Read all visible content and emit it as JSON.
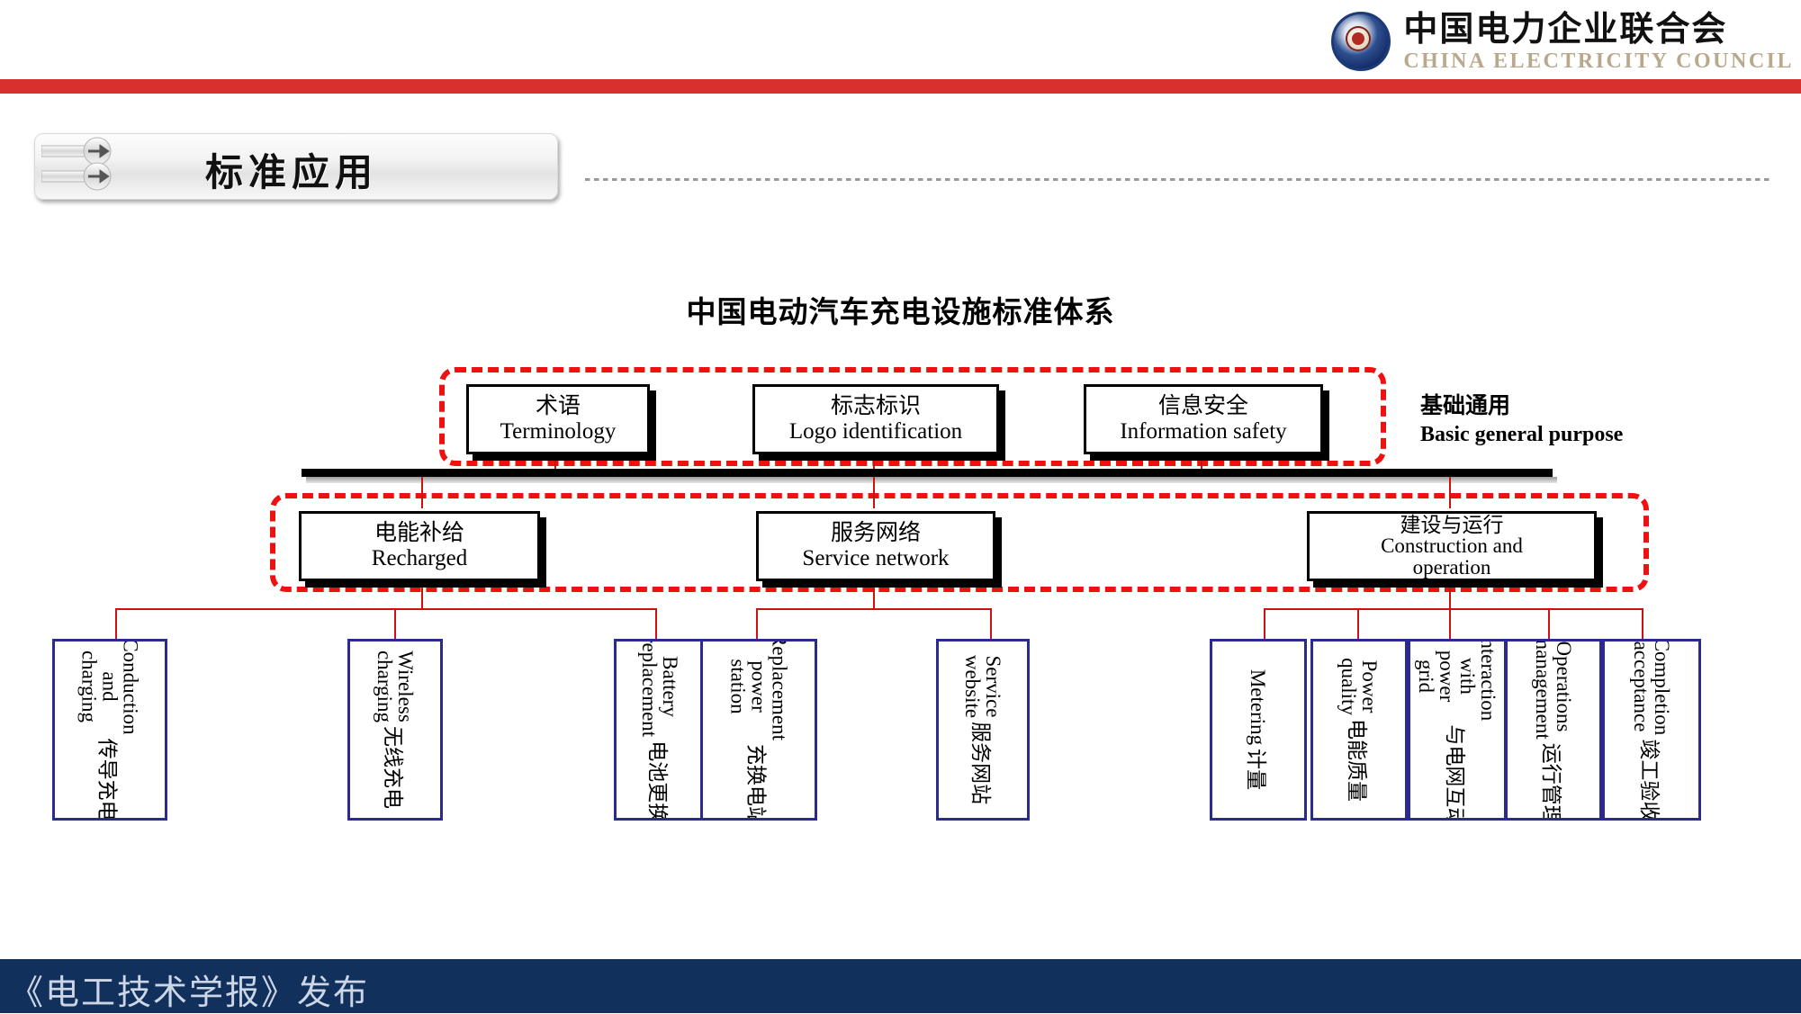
{
  "header": {
    "brand_cn": "中国电力企业联合会",
    "brand_en": "CHINA ELECTRICITY COUNCIL",
    "accent_color": "#d8302c"
  },
  "slide": {
    "title": "标准应用"
  },
  "chart_data": {
    "type": "diagram",
    "title": "中国电动汽车充电设施标准体系",
    "node_color": "#000000",
    "leaf_border_color": "#2a2a8f",
    "connector_color": "#cc1111",
    "group_outline_color": "#ee1111",
    "tiers": [
      {
        "id": "tier1",
        "side_label_cn": "基础通用",
        "side_label_en": "Basic general purpose",
        "nodes": [
          {
            "cn": "术语",
            "en": "Terminology"
          },
          {
            "cn": "标志标识",
            "en": "Logo identification"
          },
          {
            "cn": "信息安全",
            "en": "Information safety"
          }
        ]
      },
      {
        "id": "tier2",
        "side_label_cn": "",
        "side_label_en": "",
        "nodes": [
          {
            "cn": "电能补给",
            "en": "Recharged"
          },
          {
            "cn": "服务网络",
            "en": "Service network"
          },
          {
            "cn": "建设与运行",
            "en": "Construction and\noperation"
          }
        ]
      }
    ],
    "leaves": [
      {
        "cn": "传导充电",
        "en": "Conduction and\ncharging",
        "parent": "电能补给"
      },
      {
        "cn": "无线充电",
        "en": "Wireless charging",
        "parent": "电能补给"
      },
      {
        "cn": "电池更换",
        "en": "Battery replacement",
        "parent": "电能补给"
      },
      {
        "cn": "充换电站",
        "en": "Replacement power\nstation",
        "parent": "服务网络"
      },
      {
        "cn": "服务网站",
        "en": "Service website",
        "parent": "服务网络"
      },
      {
        "cn": "计量",
        "en": "Metering",
        "parent": "建设与运行"
      },
      {
        "cn": "电能质量",
        "en": "Power quality",
        "parent": "建设与运行"
      },
      {
        "cn": "与电网互动",
        "en": "Interaction with\npower grid",
        "parent": "建设与运行"
      },
      {
        "cn": "运行管理",
        "en": "Operations\nmanagement",
        "parent": "建设与运行"
      },
      {
        "cn": "竣工验收",
        "en": "Completion\nacceptance",
        "parent": "建设与运行"
      }
    ]
  },
  "footer": {
    "text": "《电工技术学报》发布",
    "background": "#12305c"
  }
}
